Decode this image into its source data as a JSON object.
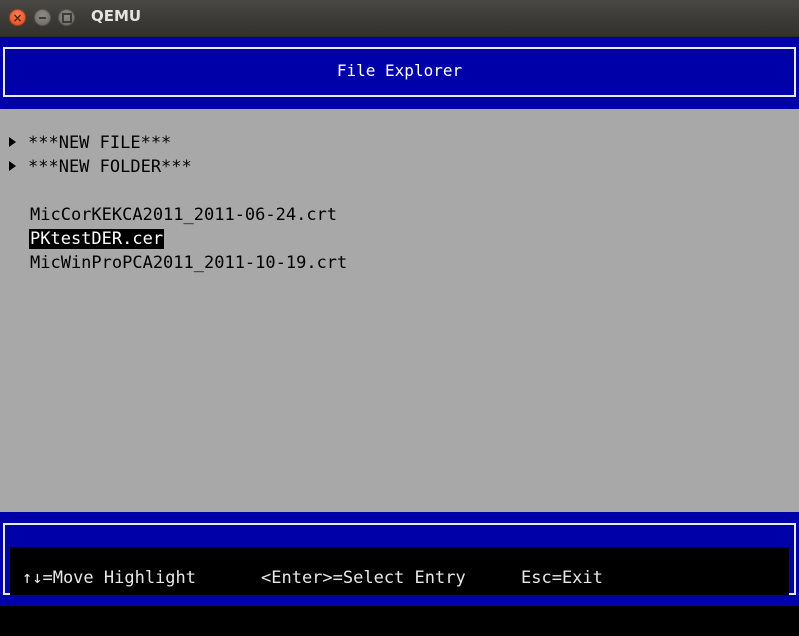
{
  "window": {
    "title": "QEMU",
    "close_glyph": "×"
  },
  "header": {
    "title": "File Explorer"
  },
  "entries": {
    "new_file": "***NEW FILE***",
    "new_folder": "***NEW FOLDER***",
    "files": [
      "MicCorKEKCA2011_2011-06-24.crt",
      "PKtestDER.cer",
      "MicWinProPCA2011_2011-10-19.crt"
    ],
    "selected_index": 1
  },
  "footer": {
    "move": "↑↓=Move Highlight",
    "enter": "<Enter>=Select Entry",
    "esc": "Esc=Exit"
  },
  "colors": {
    "bios_blue": "#0000a8",
    "body_gray": "#a8a8a8",
    "highlight_bg": "#000000",
    "highlight_fg": "#ffffff",
    "close_orange": "#df4b1c"
  },
  "icons": [
    "close-icon",
    "minimize-icon",
    "maximize-icon",
    "arrow-right-icon"
  ]
}
